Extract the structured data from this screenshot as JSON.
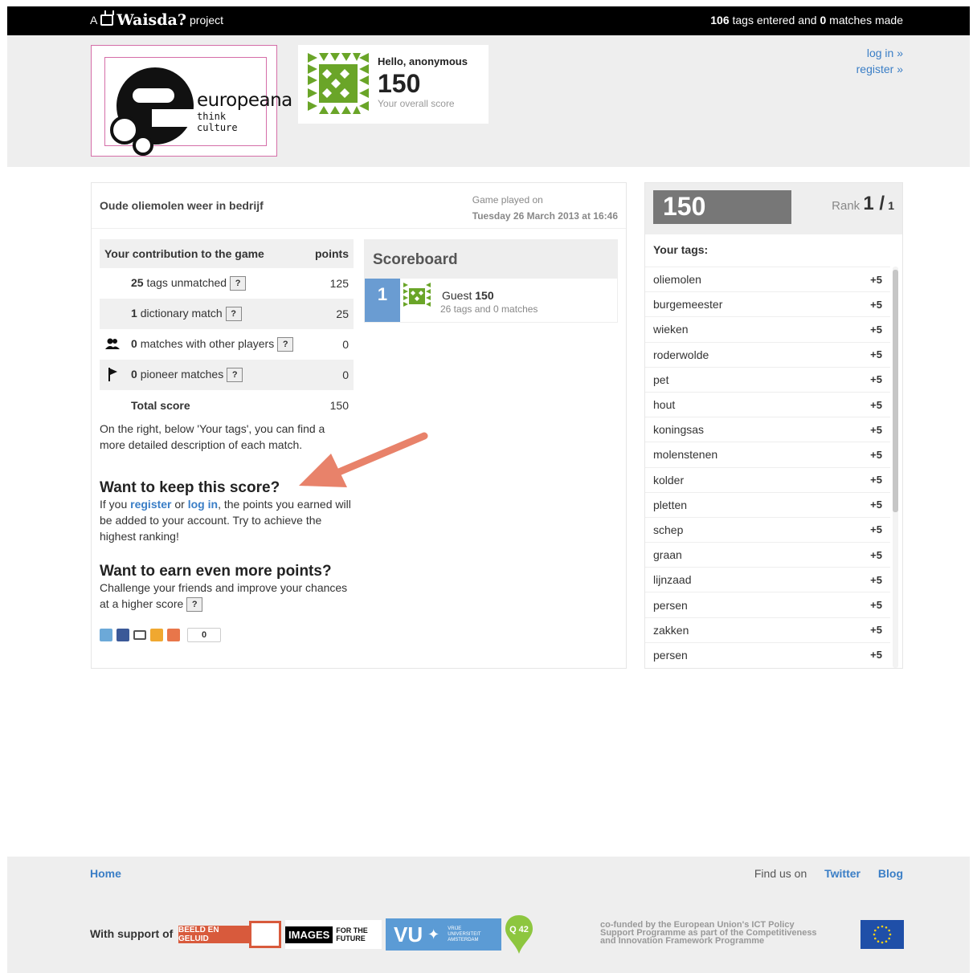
{
  "topbar": {
    "prefix": "A",
    "brand": "Waisda?",
    "suffix": "project",
    "tags_count": "106",
    "tags_text": "tags entered and",
    "matches_count": "0",
    "matches_text": "matches made"
  },
  "logo": {
    "name": "europeana",
    "tagline": "think culture"
  },
  "user": {
    "greeting": "Hello, anonymous",
    "score": "150",
    "score_label": "Your overall score"
  },
  "auth": {
    "login": "log in »",
    "register": "register »"
  },
  "game": {
    "title": "Oude oliemolen weer in bedrijf",
    "played_label": "Game played on",
    "played_date": "Tuesday 26 March 2013 at 16:46"
  },
  "contribution": {
    "header": "Your contribution to the game",
    "points_header": "points",
    "rows": [
      {
        "count": "25",
        "label": "tags unmatched",
        "help": "?",
        "points": "125"
      },
      {
        "count": "1",
        "label": "dictionary match",
        "help": "?",
        "points": "25"
      },
      {
        "count": "0",
        "label": "matches with other players",
        "help": "?",
        "points": "0"
      },
      {
        "count": "0",
        "label": "pioneer matches",
        "help": "?",
        "points": "0"
      }
    ],
    "total_label": "Total score",
    "total_value": "150",
    "note": "On the right, below 'Your tags', you can find a more detailed description of each match."
  },
  "keep": {
    "title": "Want to keep this score?",
    "text_before": "If you",
    "register_link": "register",
    "or": "or",
    "login_link": "log in",
    "text_after": ", the points you earned will be added to your account. Try to achieve the highest ranking!"
  },
  "earn": {
    "title": "Want to earn even more points?",
    "text": "Challenge your friends and improve your chances at a higher score",
    "help": "?"
  },
  "share": {
    "count": "0",
    "icons": [
      "twitter-icon",
      "facebook-icon",
      "print-icon",
      "hyves-icon",
      "addthis-icon"
    ]
  },
  "scoreboard": {
    "title": "Scoreboard",
    "entries": [
      {
        "rank": "1",
        "name": "Guest",
        "score": "150",
        "sub": "26 tags and 0 matches"
      }
    ]
  },
  "side": {
    "score": "150",
    "rank_label": "Rank",
    "rank": "1 /",
    "rank_total": "1",
    "tags_title": "Your tags:",
    "tags": [
      {
        "tag": "oliemolen",
        "pts": "+5"
      },
      {
        "tag": "burgemeester",
        "pts": "+5"
      },
      {
        "tag": "wieken",
        "pts": "+5"
      },
      {
        "tag": "roderwolde",
        "pts": "+5"
      },
      {
        "tag": "pet",
        "pts": "+5"
      },
      {
        "tag": "hout",
        "pts": "+5"
      },
      {
        "tag": "koningsas",
        "pts": "+5"
      },
      {
        "tag": "molenstenen",
        "pts": "+5"
      },
      {
        "tag": "kolder",
        "pts": "+5"
      },
      {
        "tag": "pletten",
        "pts": "+5"
      },
      {
        "tag": "schep",
        "pts": "+5"
      },
      {
        "tag": "graan",
        "pts": "+5"
      },
      {
        "tag": "lijnzaad",
        "pts": "+5"
      },
      {
        "tag": "persen",
        "pts": "+5"
      },
      {
        "tag": "zakken",
        "pts": "+5"
      },
      {
        "tag": "persen",
        "pts": "+5"
      }
    ]
  },
  "footer": {
    "home": "Home",
    "find_us": "Find us on",
    "twitter": "Twitter",
    "blog": "Blog",
    "support": "With support of",
    "beeld": "BEELD EN GELUID",
    "images": "IMAGES",
    "images_sub": "FOR THE FUTURE",
    "vu": "VU",
    "vu_sub1": "VRIJE",
    "vu_sub2": "UNIVERSITEIT",
    "vu_sub3": "AMSTERDAM",
    "q42": "Q 42",
    "funded_1": "co-funded by the European Union's ICT Policy",
    "funded_2": "Support Programme as part of the Competitiveness",
    "funded_3": "and Innovation Framework Programme"
  },
  "colors": {
    "link": "#3a7ec6",
    "rank_blue": "#6a9cd2",
    "score_grey": "#777777",
    "arrow": "#e8826a",
    "avatar_green": "#6aa528"
  }
}
